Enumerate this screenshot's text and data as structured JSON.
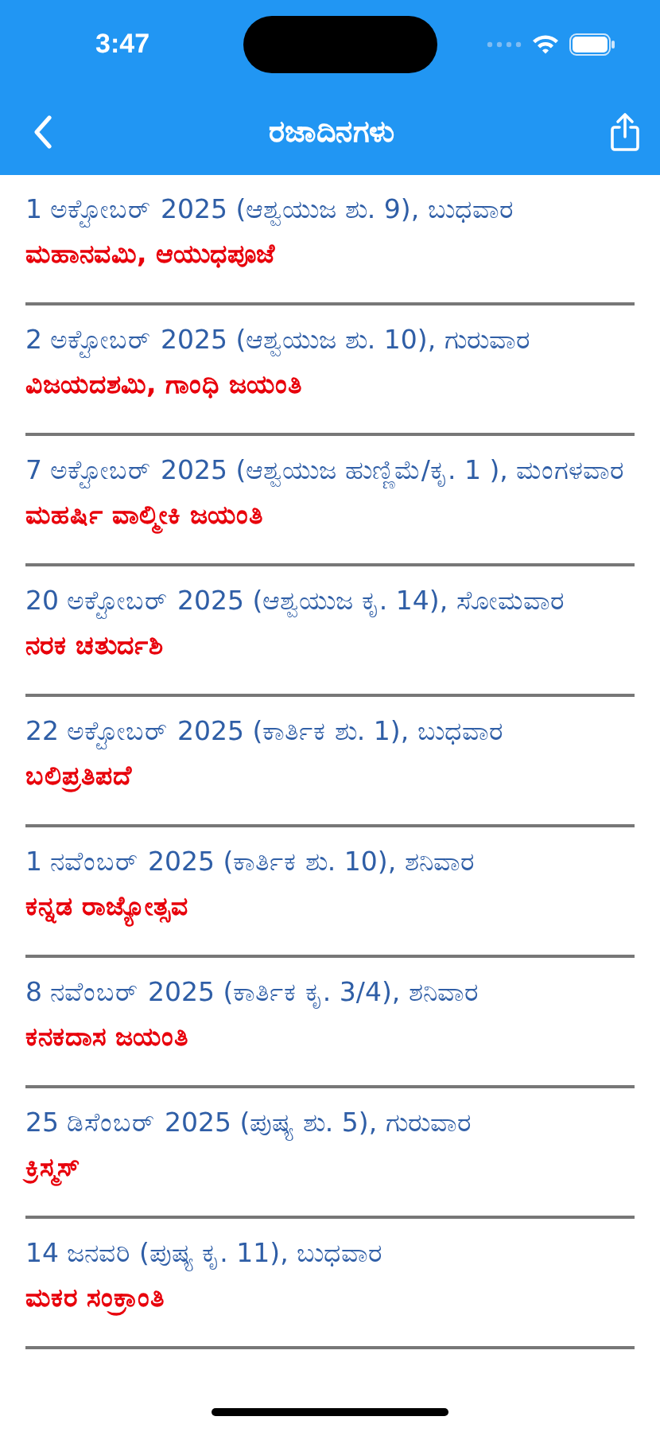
{
  "status_bar": {
    "time": "3:47"
  },
  "nav_bar": {
    "title": "ರಜಾದಿನಗಳು"
  },
  "holidays": [
    {
      "date": "1 ಅಕ್ಟೋಬರ್ 2025 (ಆಶ್ವಯುಜ ಶು. 9), ಬುಧವಾರ",
      "name": "ಮಹಾನವಮಿ, ಆಯುಧಪೂಜೆ"
    },
    {
      "date": "2 ಅಕ್ಟೋಬರ್ 2025 (ಆಶ್ವಯುಜ ಶು. 10), ಗುರುವಾರ",
      "name": "ವಿಜಯದಶಮಿ, ಗಾಂಧಿ ಜಯಂತಿ"
    },
    {
      "date": "7 ಅಕ್ಟೋಬರ್ 2025 (ಆಶ್ವಯುಜ ಹುಣ್ಣಿಮೆ/ಕೃ. 1 ), ಮಂಗಳವಾರ",
      "name": "ಮಹರ್ಷಿ ವಾಲ್ಮೀಕಿ ಜಯಂತಿ"
    },
    {
      "date": "20 ಅಕ್ಟೋಬರ್ 2025 (ಆಶ್ವಯುಜ ಕೃ. 14), ಸೋಮವಾರ",
      "name": "ನರಕ ಚತುರ್ದಶಿ"
    },
    {
      "date": "22 ಅಕ್ಟೋಬರ್ 2025 (ಕಾರ್ತಿಕ ಶು. 1), ಬುಧವಾರ",
      "name": "ಬಲಿಪ್ರತಿಪದೆ"
    },
    {
      "date": "1 ನವೆಂಬರ್ 2025 (ಕಾರ್ತಿಕ ಶು. 10), ಶನಿವಾರ",
      "name": "ಕನ್ನಡ ರಾಜ್ಯೋತ್ಸವ"
    },
    {
      "date": "8 ನವೆಂಬರ್ 2025 (ಕಾರ್ತಿಕ ಕೃ. 3/4), ಶನಿವಾರ",
      "name": "ಕನಕದಾಸ ಜಯಂತಿ"
    },
    {
      "date": "25 ಡಿಸೆಂಬರ್ 2025 (ಪುಷ್ಯ ಶು. 5), ಗುರುವಾರ",
      "name": "ಕ್ರಿಸ್ಮಸ್"
    },
    {
      "date": "14 ಜನವರಿ (ಪುಷ್ಯ ಕೃ. 11), ಬುಧವಾರ",
      "name": "ಮಕರ ಸಂಕ್ರಾಂತಿ"
    }
  ]
}
